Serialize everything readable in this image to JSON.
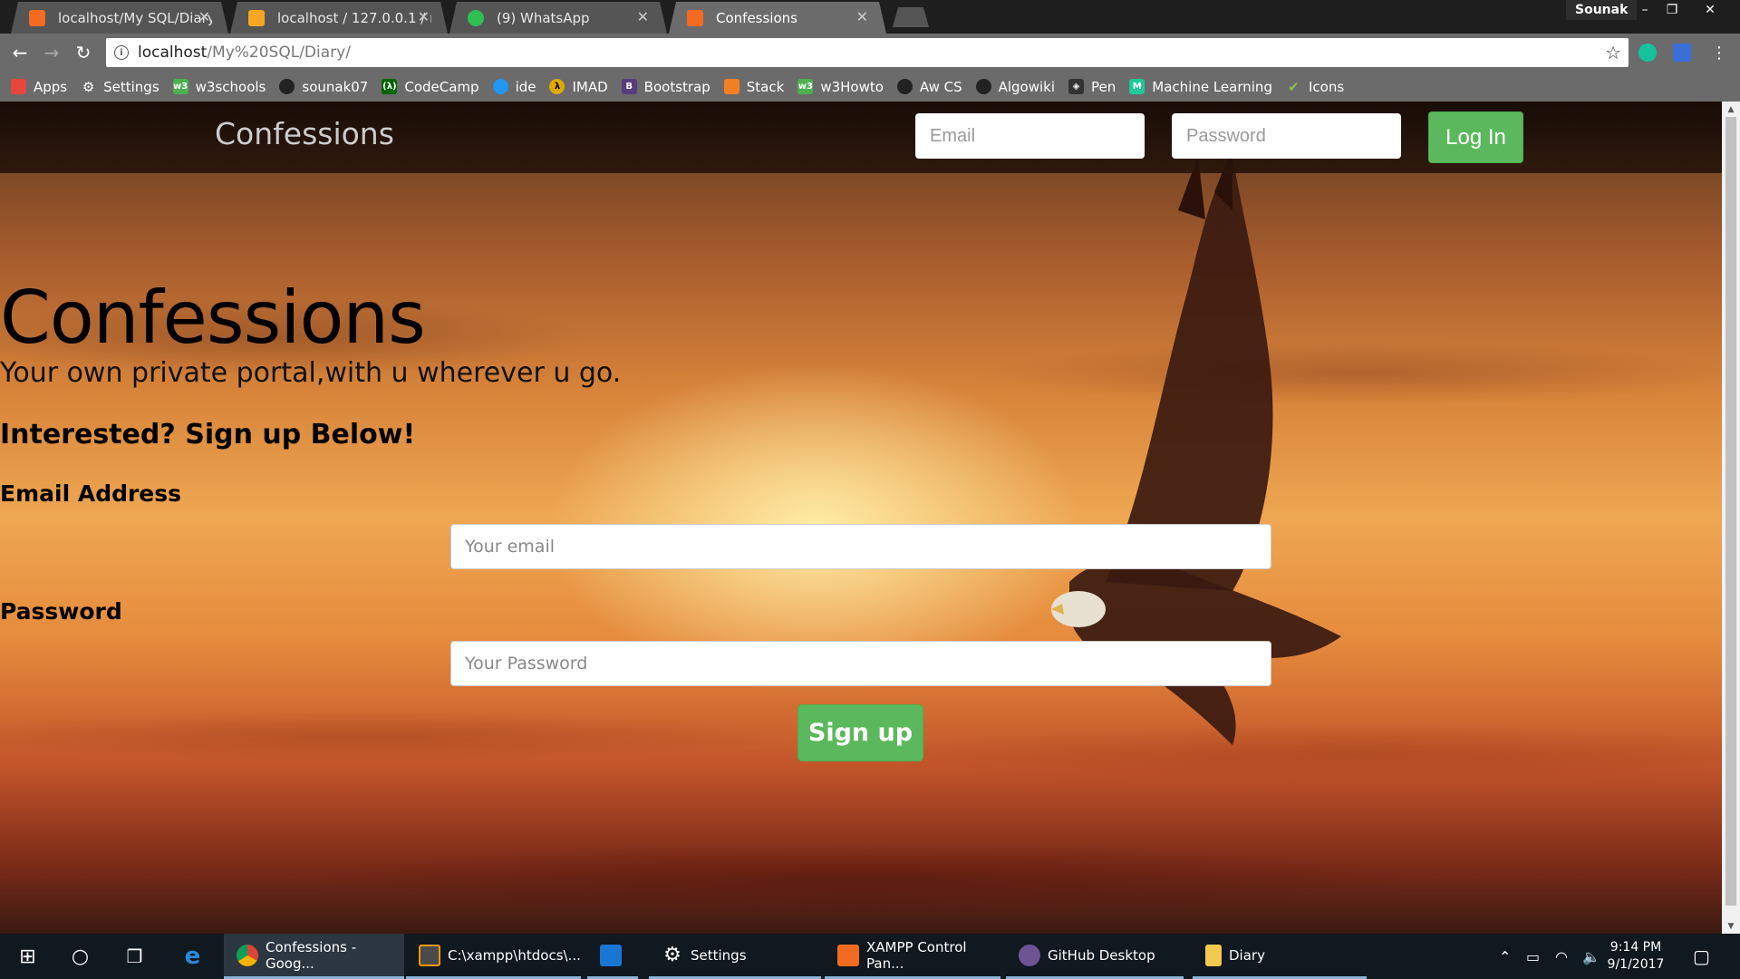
{
  "browser": {
    "tabs": [
      {
        "title": "localhost/My SQL/Diary/",
        "favicon_color": "#f26b21"
      },
      {
        "title": "localhost / 127.0.0.1 / my",
        "favicon_color": "#f5a623"
      },
      {
        "title": "(9) WhatsApp",
        "favicon_color": "#2fbf53"
      },
      {
        "title": "Confessions",
        "favicon_color": "#f26b21"
      }
    ],
    "profile_name": "Sounak",
    "url_host": "localhost",
    "url_path": "/My%20SQL/Diary/",
    "bookmarks": [
      {
        "label": "Apps",
        "icon": "apps-grid-icon",
        "color": "#e8453c"
      },
      {
        "label": "Settings",
        "icon": "gear-icon",
        "color": "#6b6b6b"
      },
      {
        "label": "w3schools",
        "icon": "w3-icon",
        "color": "#4caf50"
      },
      {
        "label": "sounak07",
        "icon": "github-icon",
        "color": "#222222"
      },
      {
        "label": "CodeCamp",
        "icon": "freecodecamp-icon",
        "color": "#006400"
      },
      {
        "label": "ide",
        "icon": "cloud-icon",
        "color": "#2196f3"
      },
      {
        "label": "IMAD",
        "icon": "imad-icon",
        "color": "#e0a800"
      },
      {
        "label": "Bootstrap",
        "icon": "bootstrap-icon",
        "color": "#563d7c"
      },
      {
        "label": "Stack",
        "icon": "stackoverflow-icon",
        "color": "#f48024"
      },
      {
        "label": "w3Howto",
        "icon": "w3-icon",
        "color": "#4caf50"
      },
      {
        "label": "Aw CS",
        "icon": "github-icon",
        "color": "#222222"
      },
      {
        "label": "Algowiki",
        "icon": "github-icon",
        "color": "#222222"
      },
      {
        "label": "Pen",
        "icon": "codepen-icon",
        "color": "#333333"
      },
      {
        "label": "Machine Learning",
        "icon": "ml-icon",
        "color": "#20c997"
      },
      {
        "label": "Icons",
        "icon": "check-icon",
        "color": "#8bc34a"
      }
    ]
  },
  "site": {
    "brand": "Confessions",
    "nav_email_placeholder": "Email",
    "nav_password_placeholder": "Password",
    "login_label": "Log In",
    "hero_title": "Confessions",
    "hero_subtitle": "Your own private portal,with u wherever u go.",
    "cta": "Interested? Sign up Below!",
    "email_label": "Email Address",
    "email_placeholder": "Your email",
    "password_label": "Password",
    "password_placeholder": "Your Password",
    "signup_label": "Sign up",
    "accent": "#5cb85c"
  },
  "taskbar": {
    "apps": [
      {
        "label": "Confessions - Goog...",
        "icon": "chrome-icon"
      },
      {
        "label": "C:\\xampp\\htdocs\\...",
        "icon": "sublime-icon"
      },
      {
        "label": "",
        "icon": "app-icon"
      },
      {
        "label": "Settings",
        "icon": "gear-icon"
      },
      {
        "label": "XAMPP Control Pan...",
        "icon": "xampp-icon"
      },
      {
        "label": "GitHub Desktop",
        "icon": "github-icon"
      },
      {
        "label": "Diary",
        "icon": "folder-icon"
      }
    ],
    "time": "9:14 PM",
    "date": "9/1/2017"
  }
}
